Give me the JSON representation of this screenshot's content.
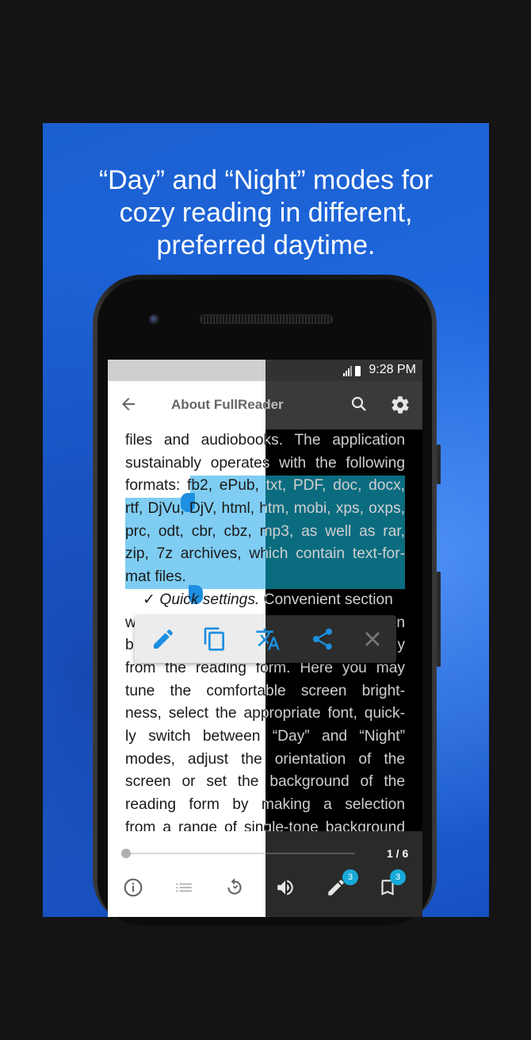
{
  "headline": {
    "line1": "“Day” and “Night” modes for",
    "line2": "cozy reading in different,",
    "line3": "preferred daytime."
  },
  "status_bar": {
    "time": "9:28 PM"
  },
  "app_bar": {
    "title": "About FullReader"
  },
  "content": {
    "lines": [
      "files and audiobooks. The application",
      "sustainably operates with the following",
      "formats: fb2, ePub, txt, PDF, doc, docx,",
      "rtf, DjVu, DjV, html, htm, mobi, xps, oxps,",
      "prc, odt, cbr, cbz, mp3, as well as rar,",
      "zip, 7z archives, which contain text-for-",
      "mat files.",
      "w",
      "b",
      "from the reading form. Here you may",
      "tune the comfortable screen bright-",
      "ness, select the appropriate font, quick-",
      "ly switch between “Day” and “Night”",
      "modes, adjust the orientation of the",
      "screen or set the background of the",
      "reading form by making a selection",
      "from a range of single-tone background"
    ],
    "formats_prefix": "formats: ",
    "formats_selected": "fb2, ePub, txt, PDF, doc, docx,",
    "quick_check": "✓",
    "quick_italic": "Quick settings.",
    "quick_rest": " Convenient section",
    "right_fragment_n": "n",
    "right_fragment_y": "y"
  },
  "selection_toolbar": {
    "icons": [
      "pencil-icon",
      "copy-icon",
      "translate-icon",
      "share-icon",
      "close-icon"
    ]
  },
  "bottom_bar": {
    "page_indicator": "1 / 6",
    "reading_progress_fraction": 0.0,
    "pencil_badge": "3",
    "bookmark_badge": "3",
    "icons": [
      "info-icon",
      "list-icon",
      "refresh-icon",
      "speaker-icon",
      "pencil-icon",
      "bookmark-icon"
    ]
  },
  "colors": {
    "background_blue": "#1f68de",
    "selection_day": "#7fcdf2",
    "selection_night": "#0b6c80",
    "accent": "#1d8fe0",
    "badge": "#18a9d8"
  }
}
